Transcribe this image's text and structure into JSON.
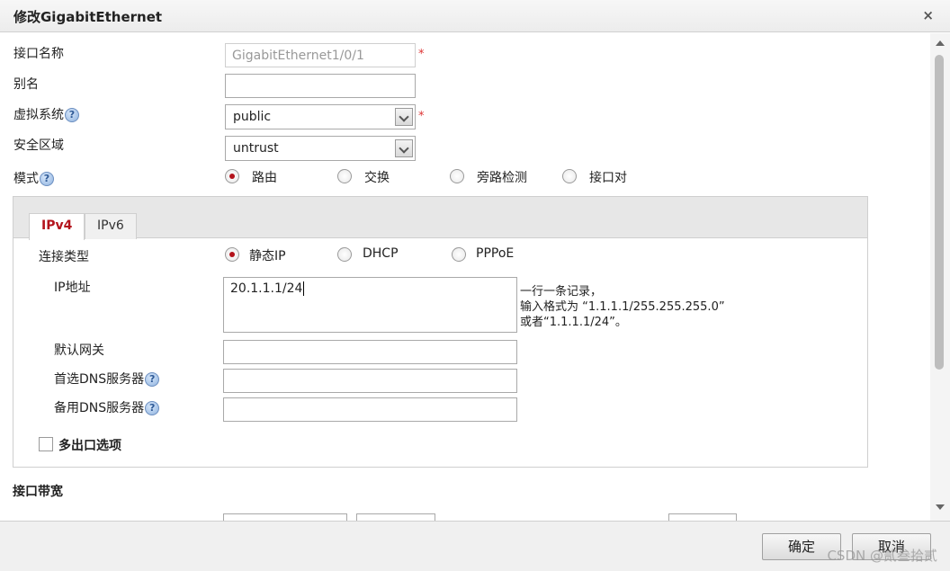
{
  "dialog": {
    "title": "修改GigabitEthernet",
    "close_glyph": "×"
  },
  "form": {
    "interface_name_label": "接口名称",
    "interface_name_value": "GigabitEthernet1/0/1",
    "required_mark": "*",
    "alias_label": "别名",
    "alias_value": "",
    "vsys_label": "虚拟系统",
    "vsys_value": "public",
    "zone_label": "安全区域",
    "zone_value": "untrust",
    "mode_label": "模式",
    "help_glyph": "?",
    "modes": [
      "路由",
      "交换",
      "旁路检测",
      "接口对"
    ],
    "mode_selected": "路由"
  },
  "tabs": [
    {
      "label": "IPv4",
      "active": true
    },
    {
      "label": "IPv6",
      "active": false
    }
  ],
  "ipv4": {
    "conn_type_label": "连接类型",
    "conn_types": [
      "静态IP",
      "DHCP",
      "PPPoE"
    ],
    "conn_type_selected": "静态IP",
    "ip_label": "IP地址",
    "ip_value": "20.1.1.1/24",
    "ip_hint_lines": [
      "一行一条记录，",
      "输入格式为 “1.1.1.1/255.255.255.0”",
      "或者“1.1.1.1/24”。"
    ],
    "gateway_label": "默认网关",
    "gateway_value": "",
    "dns1_label": "首选DNS服务器",
    "dns1_value": "",
    "dns2_label": "备用DNS服务器",
    "dns2_value": "",
    "multi_egress_label": "多出口选项",
    "multi_egress_checked": false
  },
  "bandwidth": {
    "title": "接口带宽"
  },
  "footer": {
    "ok_label": "确定",
    "cancel_label": "取消",
    "watermark": "CSDN @贰叁拾贰"
  },
  "colors": {
    "accent": "#b3131c",
    "required": "#dd3333"
  }
}
